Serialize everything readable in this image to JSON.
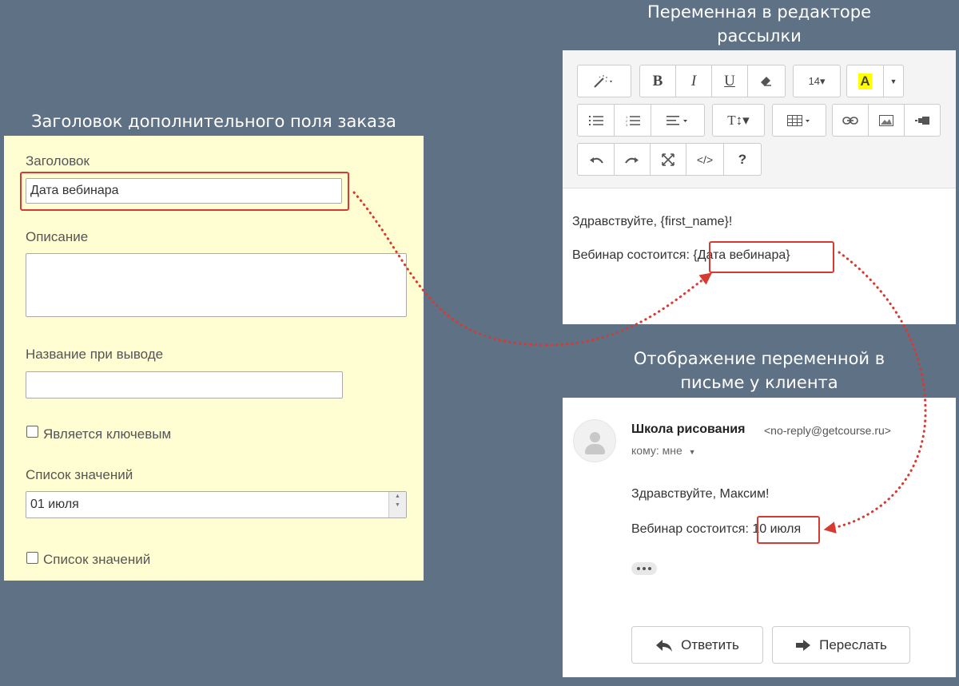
{
  "captions": {
    "editor_line1": "Переменная в редакторе",
    "editor_line2": "рассылки",
    "form": "Заголовок дополнительного поля заказа",
    "email_line1": "Отображение переменной в",
    "email_line2": "письме у клиента"
  },
  "form": {
    "title_label": "Заголовок",
    "title_value": "Дата вебинара",
    "description_label": "Описание",
    "description_value": "",
    "display_name_label": "Название при выводе",
    "display_name_value": "",
    "is_key_label": "Является ключевым",
    "values_list_label": "Список значений",
    "values_list_value": "01 июля",
    "values_list_checkbox_label": "Список значений"
  },
  "editor": {
    "toolbar": {
      "magic_icon": "magic-wand-icon",
      "bold": "B",
      "italic": "I",
      "underline": "U",
      "font_size": "14▾",
      "highlight_letter": "A",
      "text_size_label": "T↕▾",
      "help": "?",
      "code": "</>",
      "highlight_color": "#ffff00"
    },
    "line1": "Здравствуйте, {first_name}!",
    "line2_prefix": "Вебинар состоится:",
    "line2_variable": "{Дата вебинара}"
  },
  "email": {
    "sender_name": "Школа рисования",
    "sender_email": "<no-reply@getcourse.ru>",
    "recipient": "кому: мне",
    "line1": "Здравствуйте, Максим!",
    "line2_prefix": "Вебинар состоится:",
    "line2_value": "10 июля",
    "reply_label": "Ответить",
    "forward_label": "Переслать"
  },
  "colors": {
    "background": "#5f7185",
    "form_bg": "#fffed2",
    "highlight": "#d63a31"
  }
}
